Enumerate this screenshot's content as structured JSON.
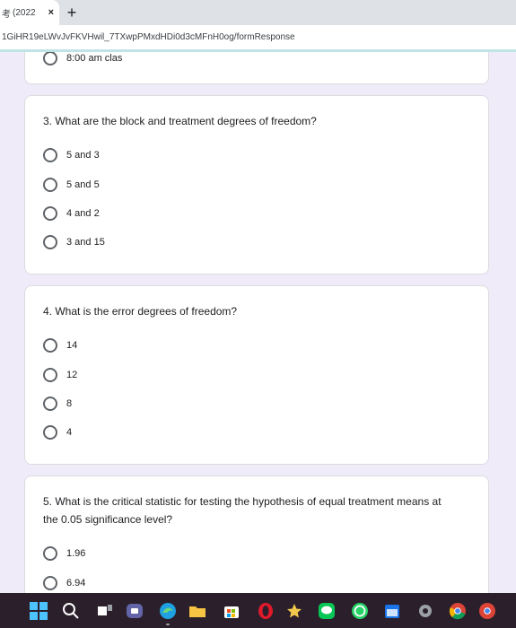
{
  "browser": {
    "tab_title": "(2022",
    "tab_icon": "考",
    "tab_close": "×",
    "new_tab": "+",
    "url": "1GiHR19eLWvJvFKVHwil_7TXwpPMxdHDi0d3cMFnH0og/formResponse"
  },
  "form": {
    "partial_option": "8:00 am clas",
    "questions": [
      {
        "text": "3. What are the block and treatment degrees of freedom?",
        "options": [
          "5 and 3",
          "5 and 5",
          "4 and 2",
          "3 and 15"
        ]
      },
      {
        "text": "4. What is the error degrees of freedom?",
        "options": [
          "14",
          "12",
          "8",
          "4"
        ]
      },
      {
        "text": "5. What is the critical statistic for testing the hypothesis of equal treatment means at the 0.05 significance level?",
        "options": [
          "1.96",
          "6.94"
        ]
      }
    ]
  },
  "taskbar": {
    "icons": [
      "windows-start-icon",
      "search-icon",
      "task-view-icon",
      "meet-icon",
      "edge-icon",
      "file-explorer-icon",
      "store-icon",
      "opera-icon",
      "star-app-icon",
      "line-icon",
      "whatsapp-icon",
      "calendar-icon",
      "settings-icon",
      "chrome-icon",
      "chrome-profile-icon"
    ]
  }
}
